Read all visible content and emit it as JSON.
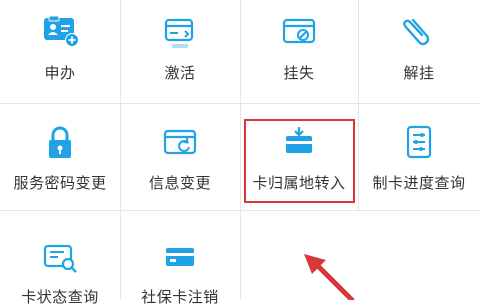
{
  "grid": {
    "rows": [
      [
        {
          "label": "申办",
          "icon": "id-card-plus-icon"
        },
        {
          "label": "激活",
          "icon": "card-activate-icon"
        },
        {
          "label": "挂失",
          "icon": "card-report-loss-icon"
        },
        {
          "label": "解挂",
          "icon": "paperclip-icon"
        }
      ],
      [
        {
          "label": "服务密码变更",
          "icon": "lock-icon"
        },
        {
          "label": "信息变更",
          "icon": "card-refresh-icon"
        },
        {
          "label": "卡归属地转入",
          "icon": "card-transfer-icon"
        },
        {
          "label": "制卡进度查询",
          "icon": "progress-list-icon"
        }
      ],
      [
        {
          "label": "卡状态查询",
          "icon": "card-search-icon"
        },
        {
          "label": "社保卡注销",
          "icon": "card-cancel-icon"
        }
      ]
    ]
  },
  "colors": {
    "accent": "#1fa3e6",
    "highlight_border": "#d8383a",
    "text": "#333333"
  }
}
